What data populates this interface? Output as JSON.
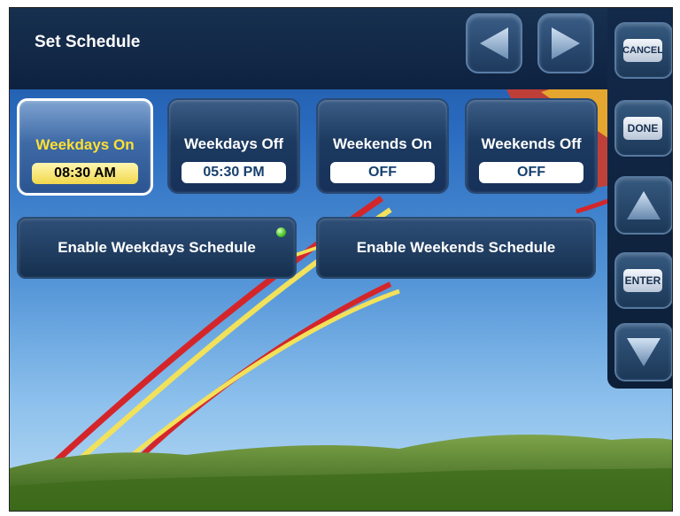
{
  "header": {
    "title": "Set Schedule"
  },
  "nav": {
    "prev_icon": "triangle-left-icon",
    "next_icon": "triangle-right-icon"
  },
  "side": {
    "cancel_label": "CANCEL",
    "done_label": "DONE",
    "enter_label": "ENTER",
    "up_icon": "triangle-up-icon",
    "down_icon": "triangle-down-icon"
  },
  "tiles": [
    {
      "label": "Weekdays On",
      "value": "08:30 AM",
      "selected": true
    },
    {
      "label": "Weekdays Off",
      "value": "05:30 PM",
      "selected": false
    },
    {
      "label": "Weekends On",
      "value": "OFF",
      "selected": false
    },
    {
      "label": "Weekends Off",
      "value": "OFF",
      "selected": false
    }
  ],
  "enable": {
    "weekdays_label": "Enable Weekdays Schedule",
    "weekdays_active": true,
    "weekends_label": "Enable Weekends Schedule",
    "weekends_active": false
  },
  "colors": {
    "accent": "#ffe033",
    "led_on": "#46c12a",
    "panel": "#13294a"
  }
}
